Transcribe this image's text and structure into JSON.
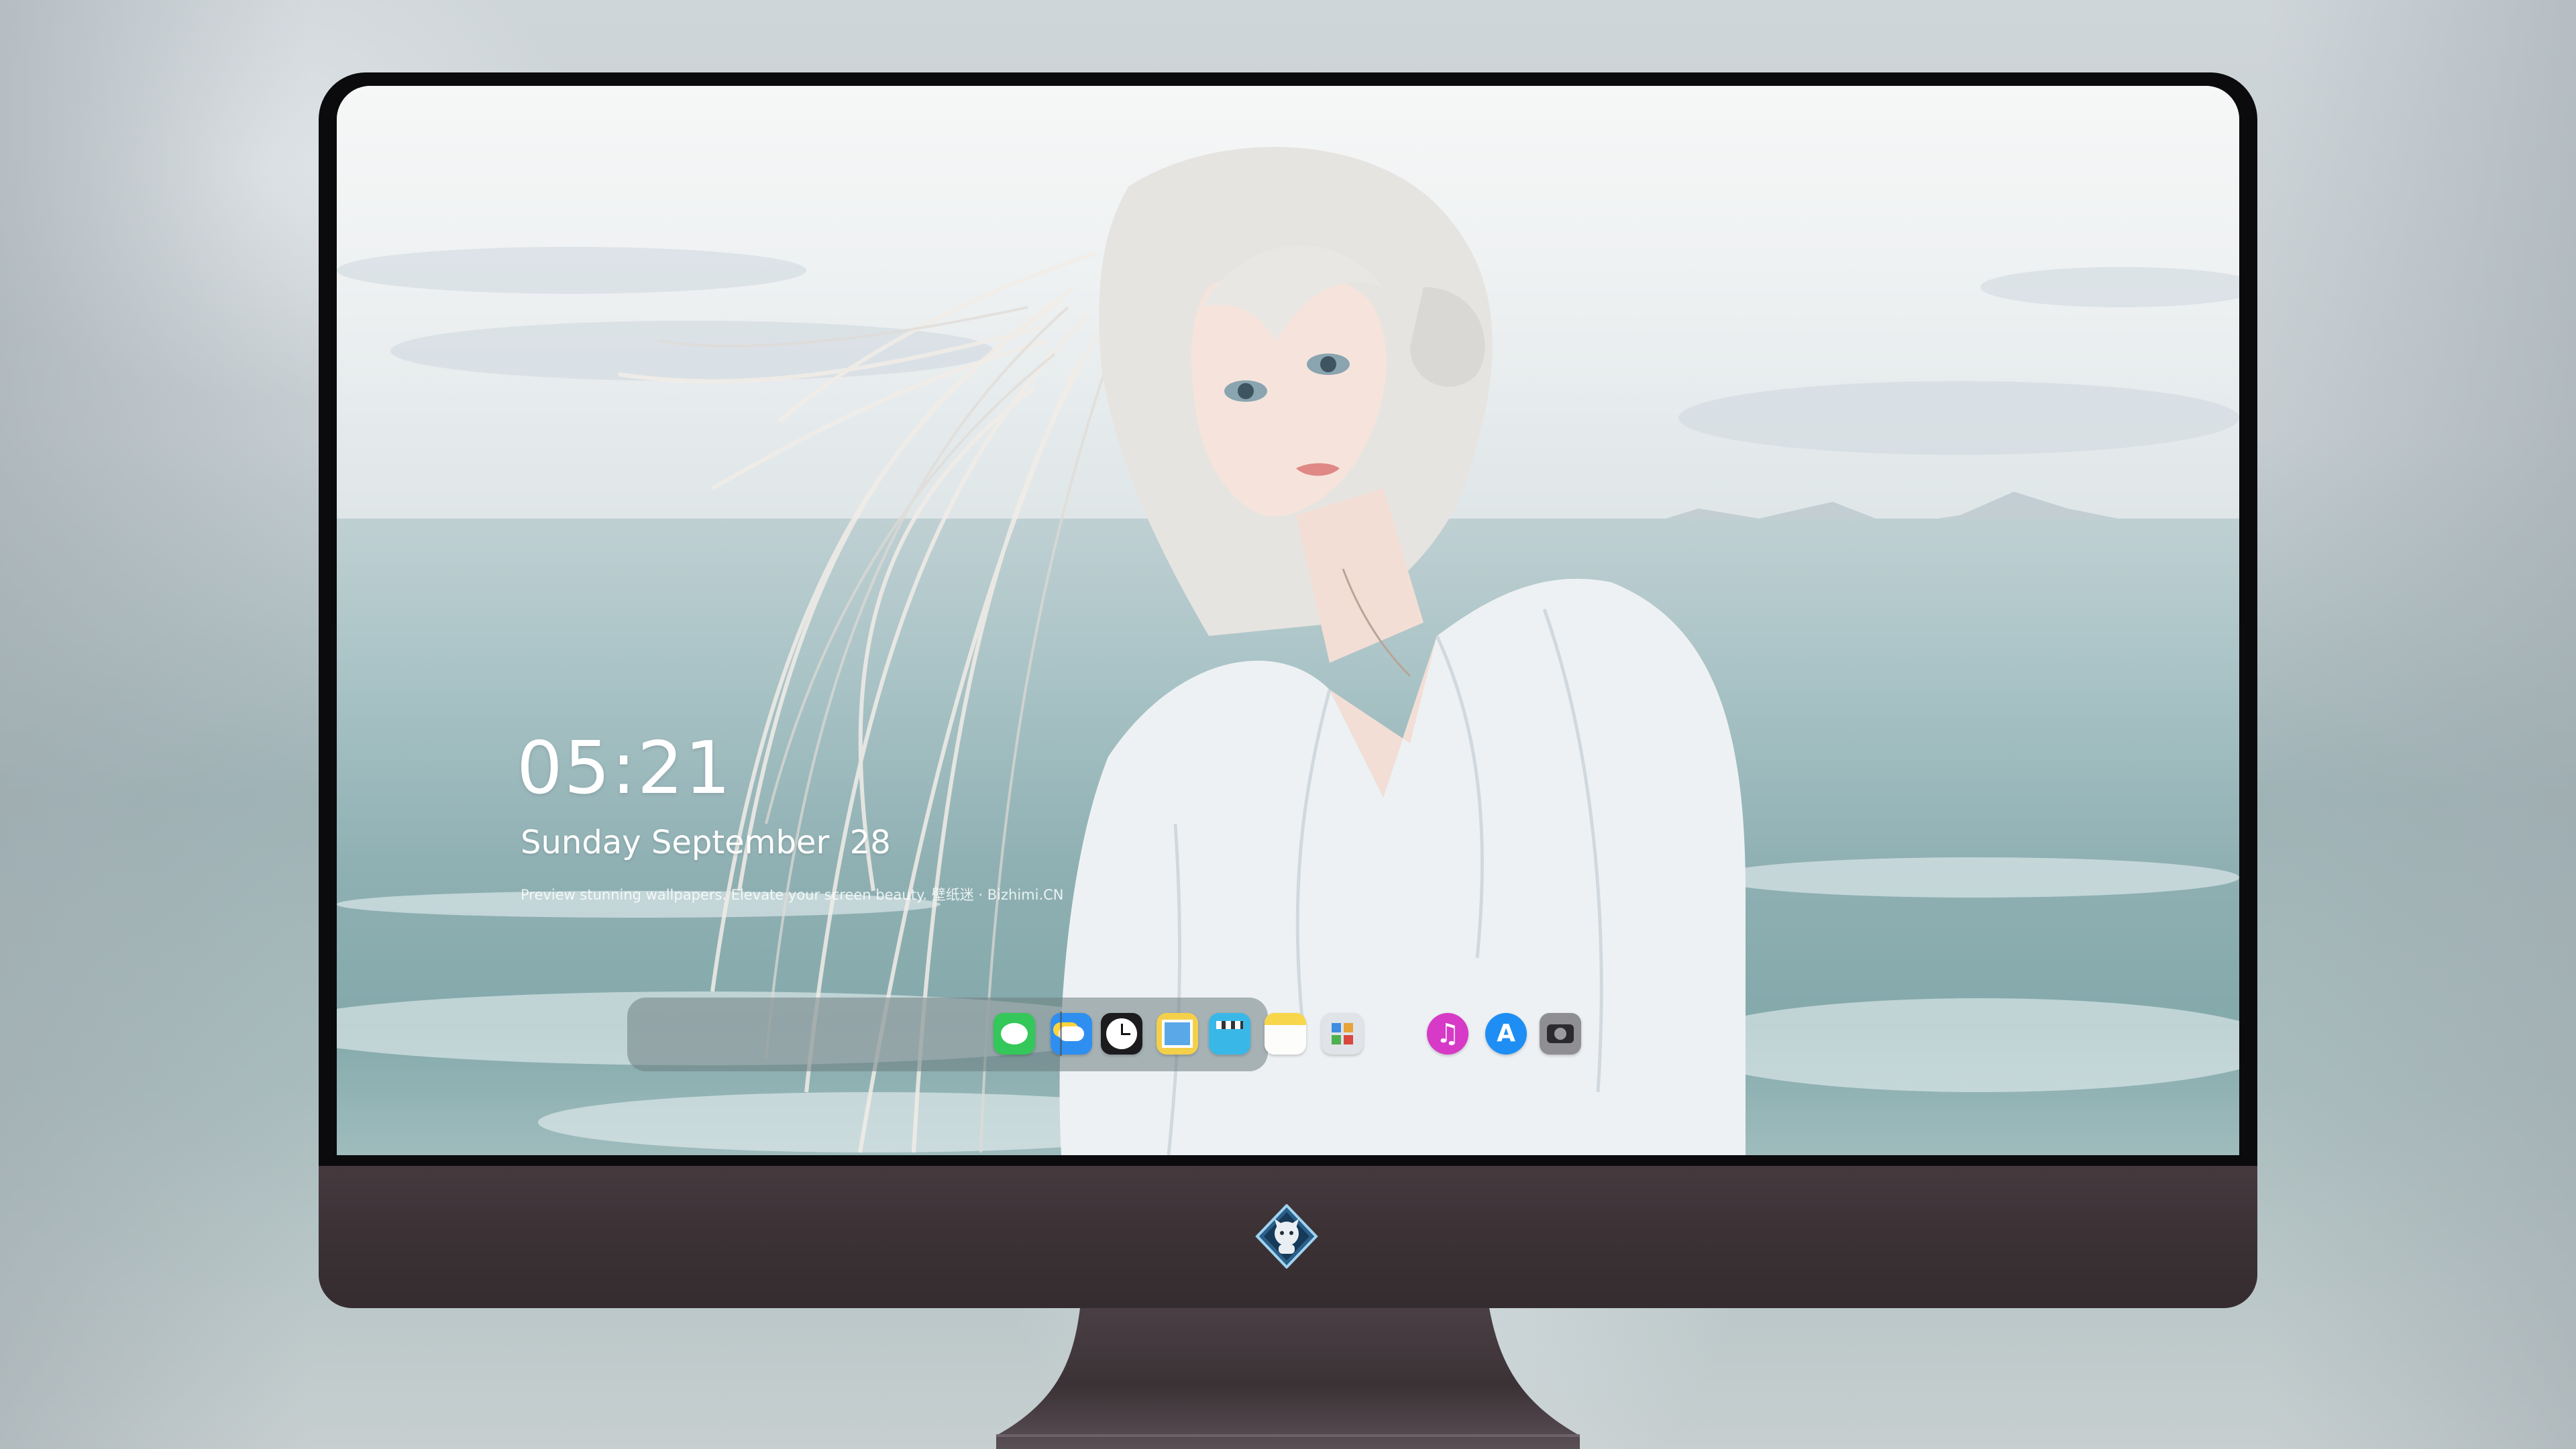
{
  "lock_screen": {
    "time": "05:21",
    "date": "Sunday September  28",
    "tagline": "Preview stunning wallpapers. Elevate your screen beauty. 壁纸迷 · Bizhimi.CN"
  },
  "dock": {
    "apps": [
      {
        "name": "Messages",
        "icon": "messages-icon",
        "glyph": "💬",
        "color": "#34c759"
      },
      {
        "name": "Weather",
        "icon": "weather-icon",
        "glyph": "⛅",
        "color": "#2f8ff0"
      },
      {
        "name": "Clock",
        "icon": "clock-icon",
        "glyph": "🕐",
        "color": "#1c1c1e"
      },
      {
        "name": "Preview",
        "icon": "preview-icon",
        "glyph": "▣",
        "color": "#f4d04a"
      },
      {
        "name": "Video",
        "icon": "video-icon",
        "glyph": "🎬",
        "color": "#39b8e8"
      },
      {
        "name": "Notes",
        "icon": "notes-icon",
        "glyph": "▤",
        "color": "#f7d64b"
      },
      {
        "name": "Calculator",
        "icon": "calculator-icon",
        "glyph": "▦",
        "color": "#e0e4e8"
      },
      {
        "name": "Music",
        "icon": "music-icon",
        "glyph": "♫",
        "color": "#d63ac6"
      },
      {
        "name": "App Store",
        "icon": "app-store-icon",
        "glyph": "A",
        "color": "#1e8ef5"
      },
      {
        "name": "Camera",
        "icon": "camera-icon",
        "glyph": "◉",
        "color": "#8e8e93"
      }
    ]
  },
  "chin": {
    "logo": "wallpaper-app-logo"
  }
}
